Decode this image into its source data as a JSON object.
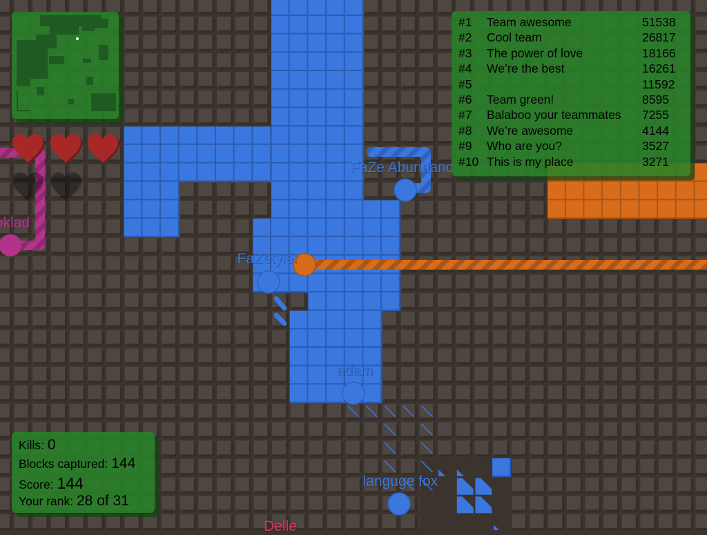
{
  "leaderboard": [
    {
      "rank": "#1",
      "name": "Team awesome",
      "score": "51538"
    },
    {
      "rank": "#2",
      "name": "Cool team",
      "score": "26817"
    },
    {
      "rank": "#3",
      "name": "The power of love",
      "score": "18166"
    },
    {
      "rank": "#4",
      "name": "We’re the best",
      "score": "16261"
    },
    {
      "rank": "#5",
      "name": "",
      "score": "11592"
    },
    {
      "rank": "#6",
      "name": "Team green!",
      "score": "8595"
    },
    {
      "rank": "#7",
      "name": "Balaboo your teammates",
      "score": "7255"
    },
    {
      "rank": "#8",
      "name": "We’re awesome",
      "score": "4144"
    },
    {
      "rank": "#9",
      "name": "Who are you?",
      "score": "3527"
    },
    {
      "rank": "#10",
      "name": "This is my place",
      "score": "3271"
    }
  ],
  "stats": {
    "kills_label": "Kills: ",
    "kills": "0",
    "blocks_label": "Blocks captured: ",
    "blocks": "144",
    "score_label": "Score: ",
    "score": "144",
    "rank_label": "Your rank: ",
    "rank": "28 of 31"
  },
  "lives": {
    "remaining": 3,
    "total": 5
  },
  "players": {
    "faze_abundance": "FaZe Abundance",
    "fazetyler": "FaZetyler",
    "adam": "adam",
    "languge_fox": "languge fox",
    "oklad": "oklad",
    "delle": "Delle"
  },
  "colors": {
    "blue": "#3a77de",
    "orange": "#d96c1a",
    "pink": "#b3338a",
    "red_name": "#d8345f",
    "panel_green": "#288228",
    "heart_red": "#a82828",
    "background": "#3b332d",
    "tile": "#4e4640"
  },
  "icons": {
    "life": "heart-icon",
    "lost_life": "heart-empty-icon"
  }
}
